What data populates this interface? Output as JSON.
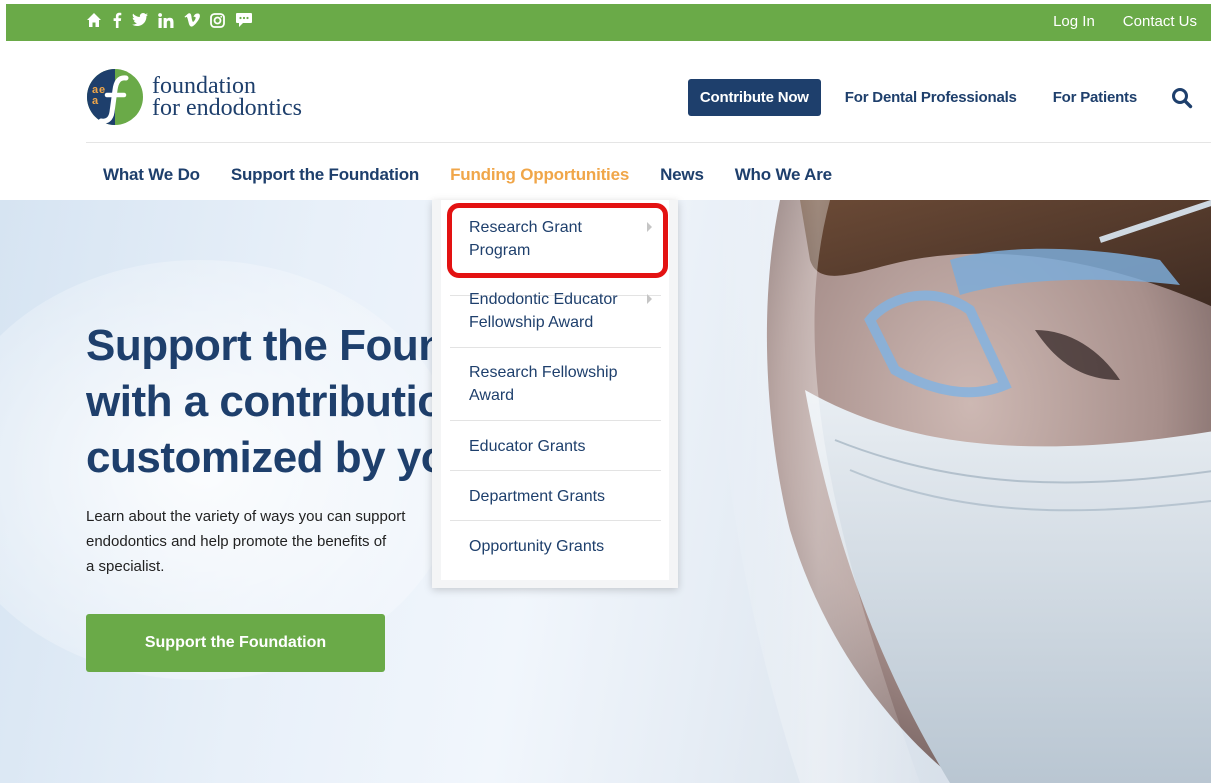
{
  "topbar": {
    "social_icons": [
      "home-icon",
      "facebook-icon",
      "twitter-icon",
      "linkedin-icon",
      "vimeo-icon",
      "instagram-icon",
      "chat-icon"
    ],
    "login": "Log In",
    "contact": "Contact Us"
  },
  "header": {
    "logo_line1": "foundation",
    "logo_line2": "for endodontics",
    "contribute": "Contribute Now",
    "dental_pros": "For Dental Professionals",
    "patients": "For Patients"
  },
  "nav": {
    "items": [
      "What We Do",
      "Support the Foundation",
      "Funding Opportunities",
      "News",
      "Who We Are"
    ],
    "active": "Funding Opportunities"
  },
  "dropdown": {
    "items": [
      {
        "label": "Research Grant Program",
        "has_submenu": true
      },
      {
        "label": "Endodontic Educator Fellowship Award",
        "has_submenu": true
      },
      {
        "label": "Research Fellowship Award",
        "has_submenu": false
      },
      {
        "label": "Educator Grants",
        "has_submenu": false
      },
      {
        "label": "Department Grants",
        "has_submenu": false
      },
      {
        "label": "Opportunity Grants",
        "has_submenu": false
      }
    ]
  },
  "hero": {
    "title_line1": "Support the Foundation",
    "title_line2": "with a contribution",
    "title_line3": "customized by you",
    "text_line1": "Learn about the variety of ways you can support",
    "text_line2": "endodontics and help promote the benefits of",
    "text_line3": "a specialist.",
    "button": "Support the Foundation"
  },
  "colors": {
    "green": "#6aaa48",
    "navy": "#1e3f6c",
    "orange": "#f0a649",
    "highlight_red": "#e31212"
  }
}
